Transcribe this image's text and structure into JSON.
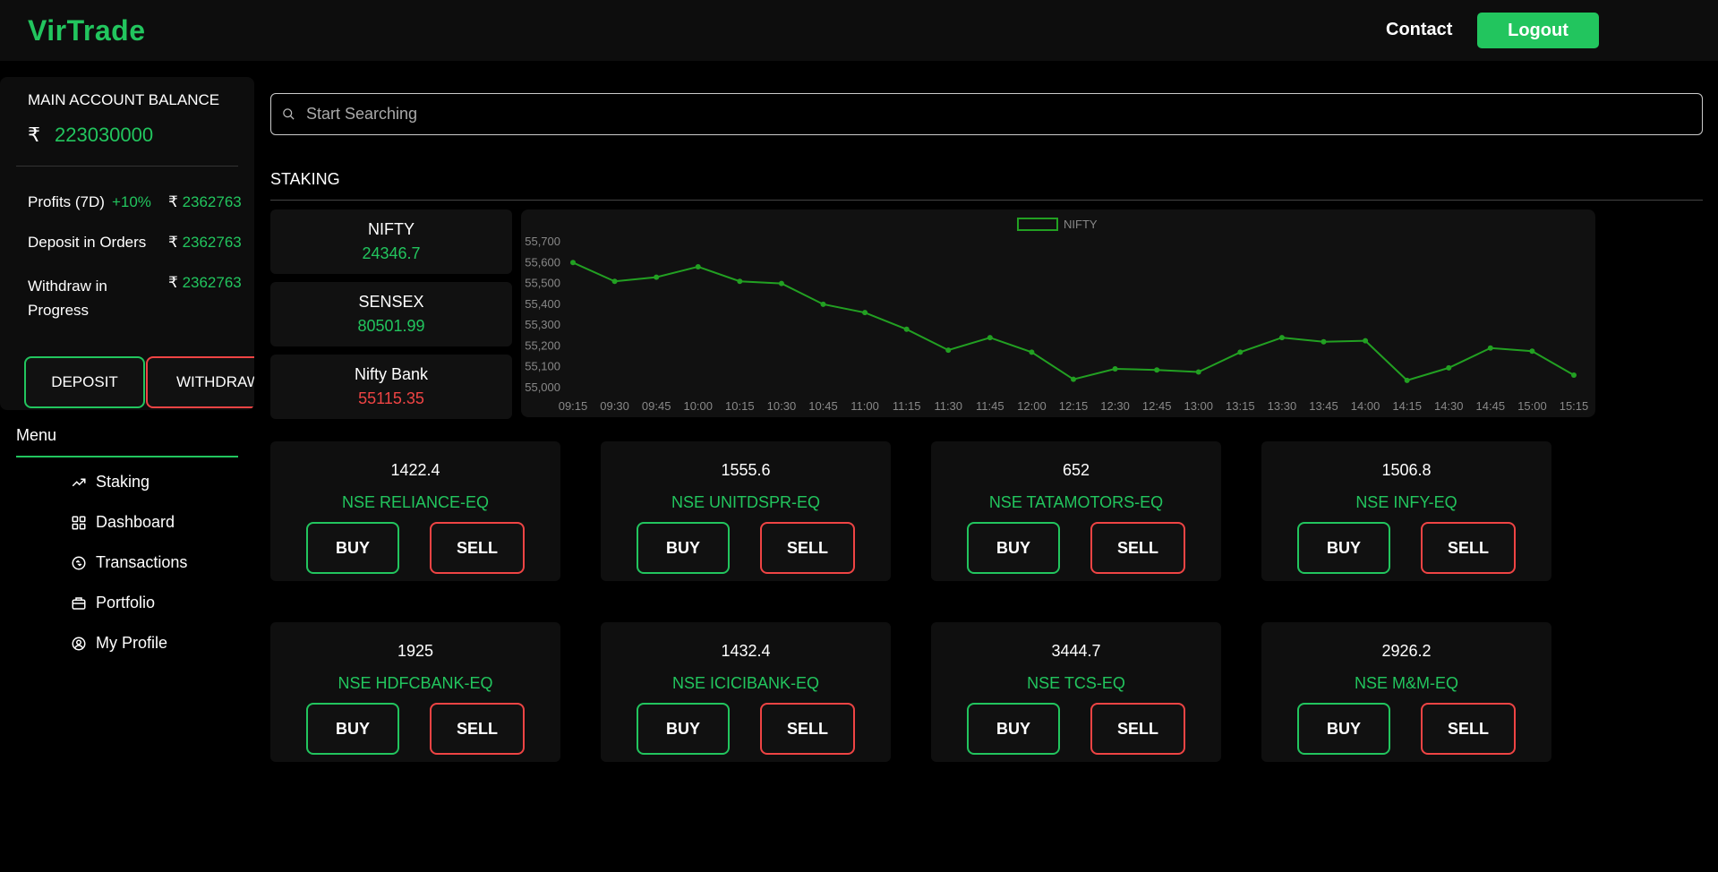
{
  "header": {
    "logo": "VirTrade",
    "contact": "Contact",
    "logout": "Logout"
  },
  "account": {
    "title": "MAIN ACCOUNT BALANCE",
    "currency": "₹",
    "balance": "223030000",
    "profits_label": "Profits (7D)",
    "profits_pct": "+10%",
    "profits_value": "2362763",
    "deposit_orders_label": "Deposit in Orders",
    "deposit_orders_value": "2362763",
    "withdraw_label_1": "Withdraw in",
    "withdraw_label_2": "Progress",
    "withdraw_value": "2362763",
    "deposit_btn": "DEPOSIT",
    "withdraw_btn": "WITHDRAW"
  },
  "menu": {
    "title": "Menu",
    "items": [
      {
        "label": "Staking",
        "icon": "trending-up-icon"
      },
      {
        "label": "Dashboard",
        "icon": "dashboard-grid-icon"
      },
      {
        "label": "Transactions",
        "icon": "transactions-icon"
      },
      {
        "label": "Portfolio",
        "icon": "briefcase-icon"
      },
      {
        "label": "My Profile",
        "icon": "user-circle-icon"
      }
    ]
  },
  "search": {
    "placeholder": "Start Searching"
  },
  "section": {
    "title": "STAKING"
  },
  "indices": [
    {
      "name": "NIFTY",
      "value": "24346.7",
      "color": "#22c55e"
    },
    {
      "name": "SENSEX",
      "value": "80501.99",
      "color": "#22c55e"
    },
    {
      "name": "Nifty Bank",
      "value": "55115.35",
      "color": "#ef4444"
    }
  ],
  "chart_data": {
    "type": "line",
    "series": [
      {
        "name": "NIFTY",
        "values": [
          55600,
          55510,
          55530,
          55580,
          55510,
          55500,
          55400,
          55360,
          55280,
          55180,
          55240,
          55170,
          55040,
          55090,
          55085,
          55075,
          55170,
          55240,
          55220,
          55225,
          55035,
          55095,
          55190,
          55175,
          55060
        ]
      }
    ],
    "x": [
      "09:15",
      "09:30",
      "09:45",
      "10:00",
      "10:15",
      "10:30",
      "10:45",
      "11:00",
      "11:15",
      "11:30",
      "11:45",
      "12:00",
      "12:15",
      "12:30",
      "12:45",
      "13:00",
      "13:15",
      "13:30",
      "13:45",
      "14:00",
      "14:15",
      "14:30",
      "14:45",
      "15:00",
      "15:15"
    ],
    "yticks": [
      "55,700",
      "55,600",
      "55,500",
      "55,400",
      "55,300",
      "55,200",
      "55,100",
      "55,000"
    ],
    "ylim": [
      55000,
      55700
    ],
    "line_color": "#22a022",
    "grid": false,
    "legend": "top-center"
  },
  "stocks": [
    {
      "price": "1422.4",
      "symbol": "NSE RELIANCE-EQ",
      "buy": "BUY",
      "sell": "SELL"
    },
    {
      "price": "1555.6",
      "symbol": "NSE UNITDSPR-EQ",
      "buy": "BUY",
      "sell": "SELL"
    },
    {
      "price": "652",
      "symbol": "NSE TATAMOTORS-EQ",
      "buy": "BUY",
      "sell": "SELL"
    },
    {
      "price": "1506.8",
      "symbol": "NSE INFY-EQ",
      "buy": "BUY",
      "sell": "SELL"
    },
    {
      "price": "1925",
      "symbol": "NSE HDFCBANK-EQ",
      "buy": "BUY",
      "sell": "SELL"
    },
    {
      "price": "1432.4",
      "symbol": "NSE ICICIBANK-EQ",
      "buy": "BUY",
      "sell": "SELL"
    },
    {
      "price": "3444.7",
      "symbol": "NSE TCS-EQ",
      "buy": "BUY",
      "sell": "SELL"
    },
    {
      "price": "2926.2",
      "symbol": "NSE M&M-EQ",
      "buy": "BUY",
      "sell": "SELL"
    }
  ]
}
